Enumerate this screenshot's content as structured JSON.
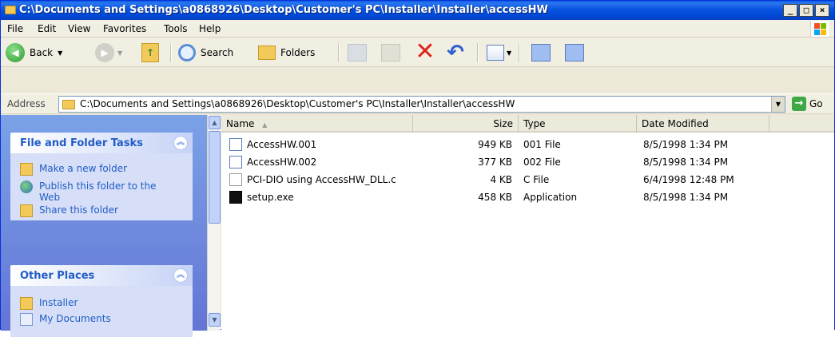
{
  "window": {
    "title": "C:\\Documents and Settings\\a0868926\\Desktop\\Customer's PC\\Installer\\Installer\\accessHW",
    "minimize": "_",
    "maximize": "□",
    "close": "×"
  },
  "menu": [
    "File",
    "Edit",
    "View",
    "Favorites",
    "Tools",
    "Help"
  ],
  "toolbar": {
    "back": "Back",
    "search": "Search",
    "folders": "Folders"
  },
  "address": {
    "label": "Address",
    "value": "C:\\Documents and Settings\\a0868926\\Desktop\\Customer's PC\\Installer\\Installer\\accessHW",
    "go": "Go"
  },
  "tasks_panel": {
    "title": "File and Folder Tasks",
    "items": [
      "Make a new folder",
      "Publish this folder to the Web",
      "Share this folder"
    ]
  },
  "places_panel": {
    "title": "Other Places",
    "items": [
      "Installer",
      "My Documents"
    ]
  },
  "columns": [
    "Name",
    "Size",
    "Type",
    "Date Modified"
  ],
  "files": [
    {
      "name": "AccessHW.001",
      "size": "949 KB",
      "type": "001 File",
      "date": "8/5/1998 1:34 PM",
      "icon": "generic-file-icon"
    },
    {
      "name": "AccessHW.002",
      "size": "377 KB",
      "type": "002 File",
      "date": "8/5/1998 1:34 PM",
      "icon": "generic-file-icon"
    },
    {
      "name": "PCI-DIO using AccessHW_DLL.c",
      "size": "4 KB",
      "type": "C File",
      "date": "6/4/1998 12:48 PM",
      "icon": "text-file-icon"
    },
    {
      "name": "setup.exe",
      "size": "458 KB",
      "type": "Application",
      "date": "8/5/1998 1:34 PM",
      "icon": "setup-exe-icon"
    }
  ]
}
